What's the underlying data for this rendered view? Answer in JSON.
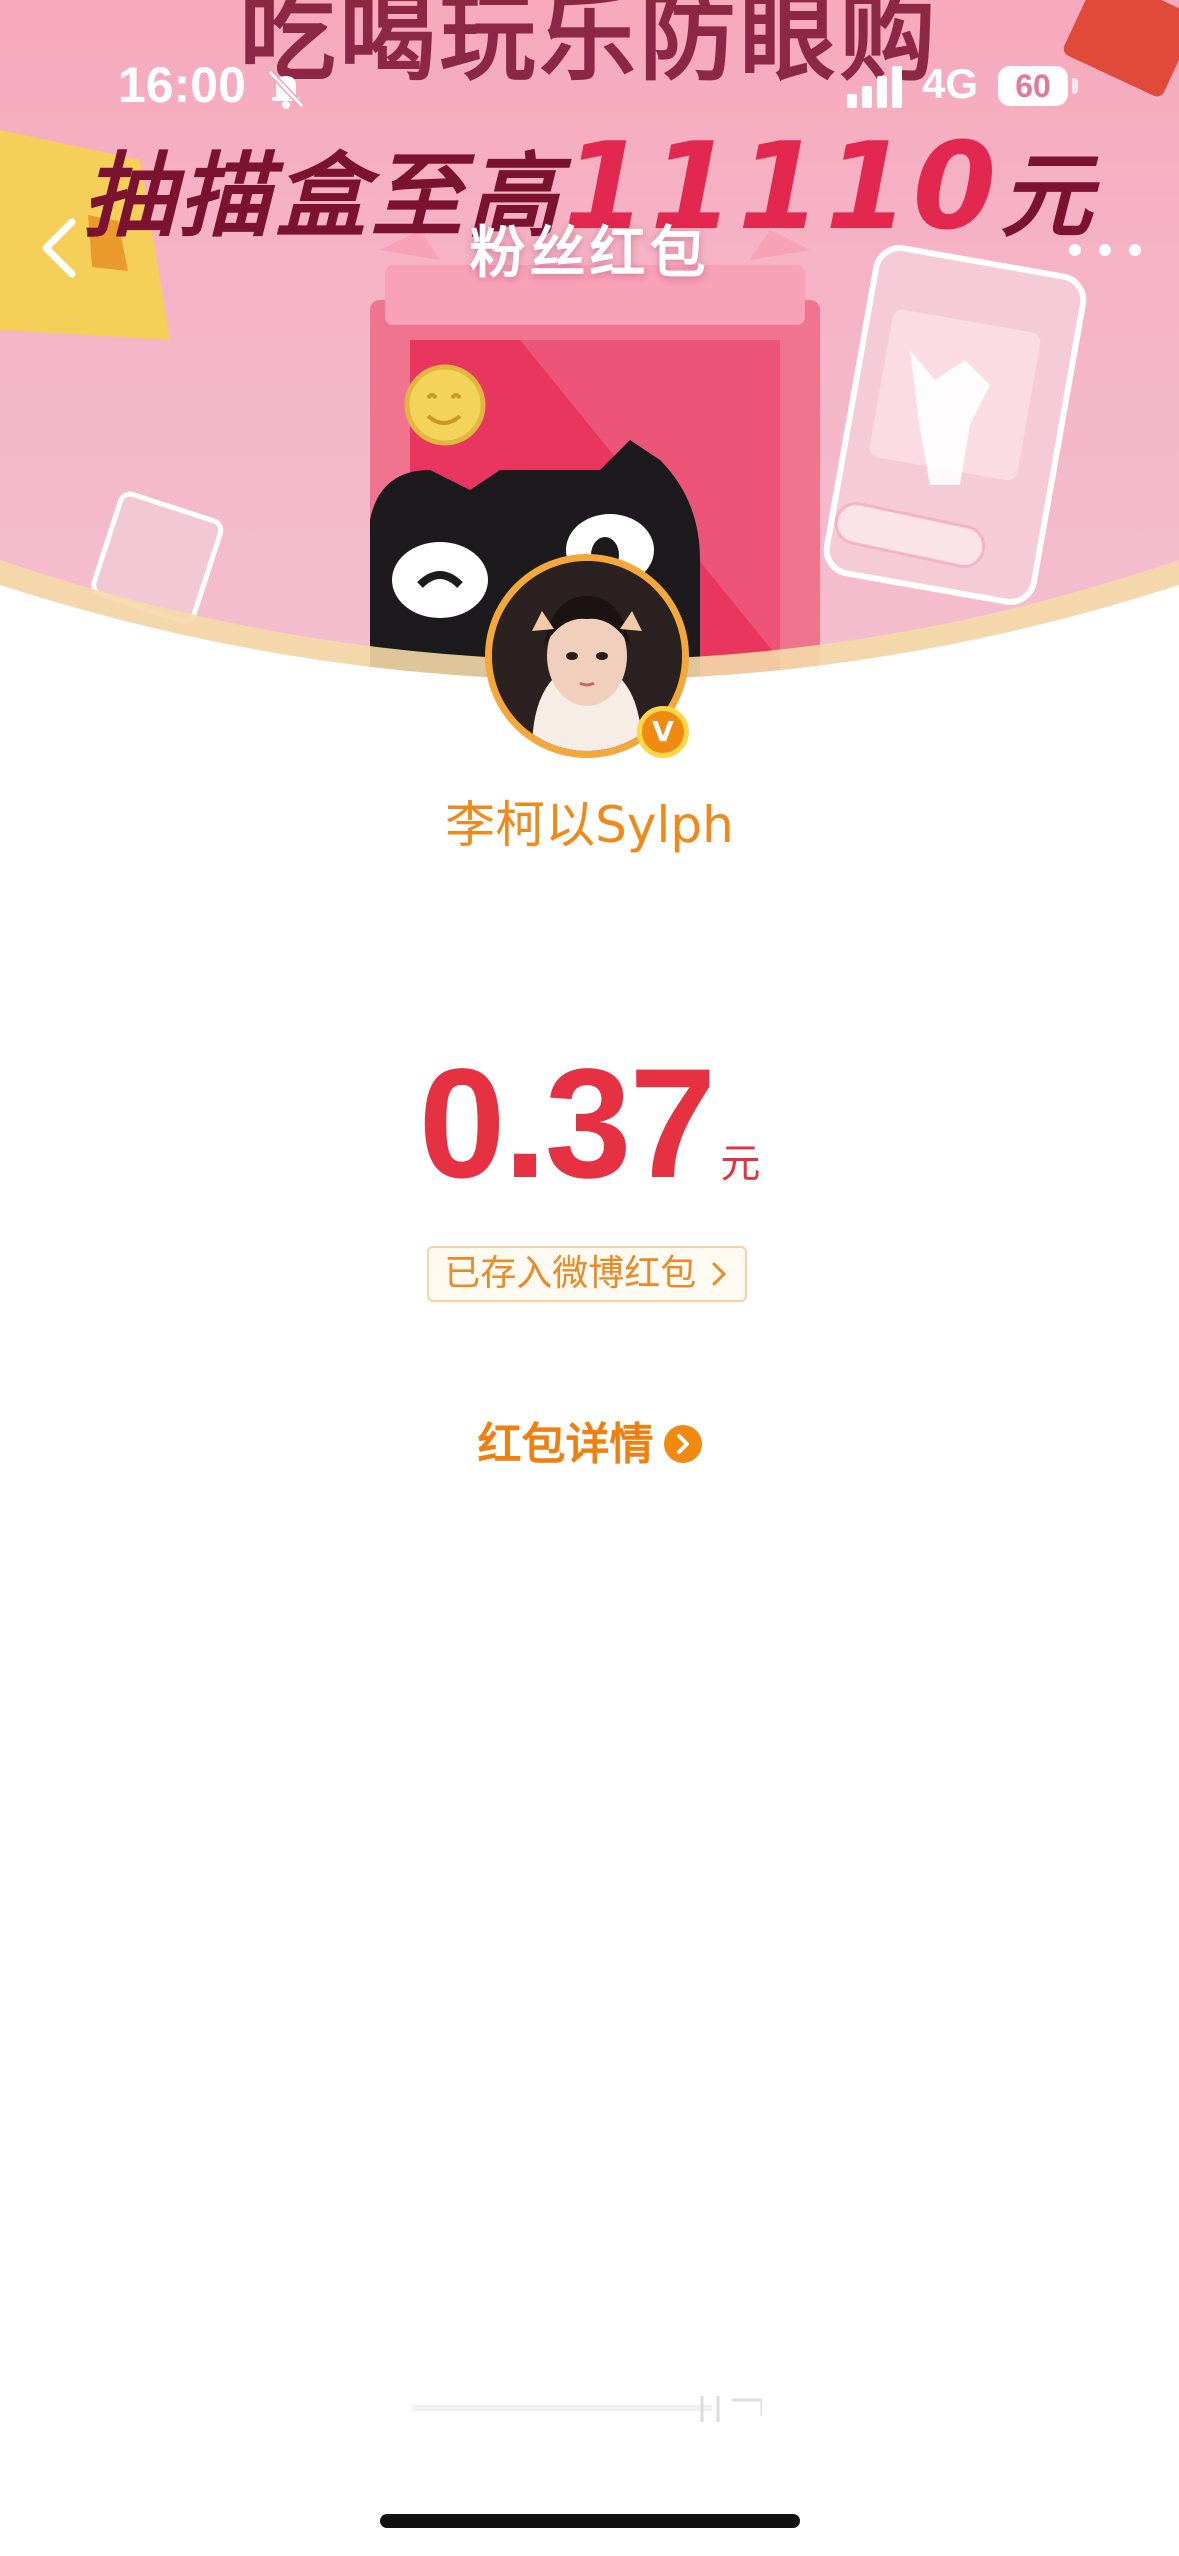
{
  "status_bar": {
    "time": "16:00",
    "network": "4G",
    "battery": "60"
  },
  "banner": {
    "promo_line1": "吃喝玩乐防眼购",
    "promo_line2_prefix": "抽描盒至高",
    "promo_amount": "11110",
    "promo_unit": "元"
  },
  "nav": {
    "title": "粉丝红包"
  },
  "sender": {
    "name": "李柯以Sylph",
    "badge": "V"
  },
  "red_packet": {
    "amount": "0.37",
    "unit": "元",
    "deposit_label": "已存入微博红包",
    "detail_label": "红包详情"
  },
  "colors": {
    "accent_orange": "#f07f10",
    "amount_red": "#e53142",
    "banner_pink": "#f5b4c6"
  }
}
